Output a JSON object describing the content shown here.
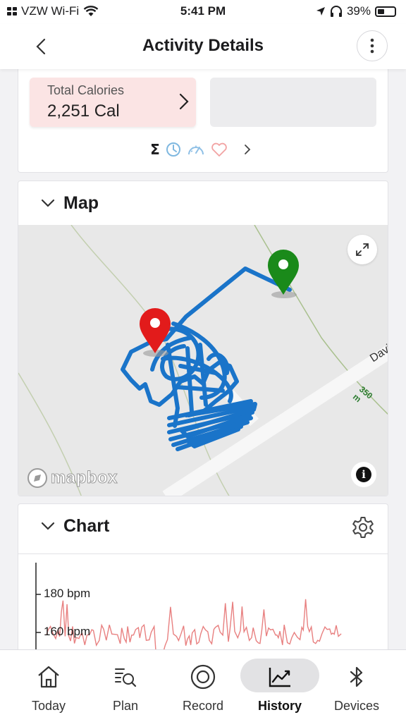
{
  "status_bar": {
    "carrier": "VZW Wi-Fi",
    "time": "5:41 PM",
    "battery": "39%",
    "battery_level": 0.39
  },
  "nav": {
    "title": "Activity Details"
  },
  "summary": {
    "calories_label": "Total Calories",
    "calories_value": "2,251 Cal",
    "metric_icons": [
      "sigma-icon",
      "clock-icon",
      "speedometer-icon",
      "heart-icon",
      "chevron-right-icon"
    ]
  },
  "map": {
    "title": "Map",
    "attribution": "mapbox",
    "road_label": "Davi",
    "contour_label": "350 m"
  },
  "chart": {
    "title": "Chart",
    "tick_labels": [
      "180 bpm",
      "160 bpm"
    ]
  },
  "tabs": [
    {
      "label": "Today",
      "icon": "home-icon"
    },
    {
      "label": "Plan",
      "icon": "plan-search-icon"
    },
    {
      "label": "Record",
      "icon": "record-icon"
    },
    {
      "label": "History",
      "icon": "trend-chart-icon",
      "active": true
    },
    {
      "label": "Devices",
      "icon": "bluetooth-icon"
    }
  ],
  "colors": {
    "route": "#1a74c9",
    "start_pin": "#1a8a1a",
    "end_pin": "#e21b1b",
    "hr_line": "#e88080",
    "calorie_tile": "#fbe4e4"
  }
}
